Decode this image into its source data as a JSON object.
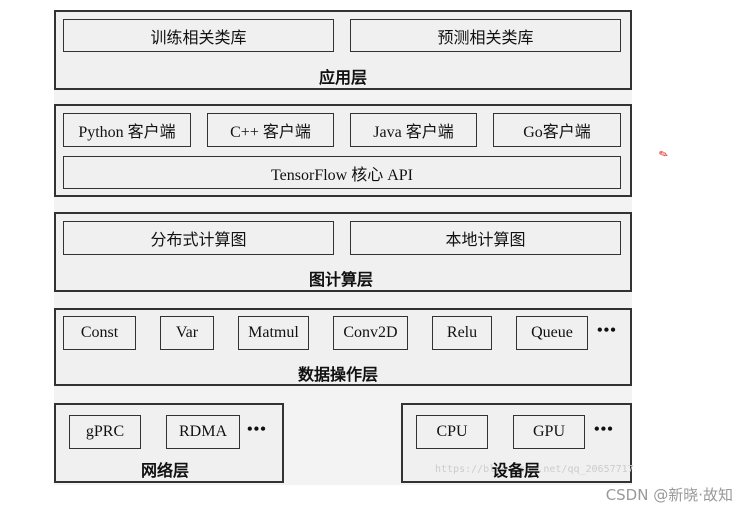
{
  "application_layer": {
    "label": "应用层",
    "items": [
      "训练相关类库",
      "预测相关类库"
    ]
  },
  "client_layer": {
    "items": [
      "Python 客户端",
      "C++ 客户端",
      "Java 客户端",
      "Go客户端"
    ],
    "core_api": "TensorFlow 核心 API"
  },
  "graph_layer": {
    "label": "图计算层",
    "items": [
      "分布式计算图",
      "本地计算图"
    ]
  },
  "data_op_layer": {
    "label": "数据操作层",
    "items": [
      "Const",
      "Var",
      "Matmul",
      "Conv2D",
      "Relu",
      "Queue"
    ],
    "more": "•••"
  },
  "network_layer": {
    "label": "网络层",
    "items": [
      "gPRC",
      "RDMA"
    ],
    "more": "•••"
  },
  "device_layer": {
    "label": "设备层",
    "items": [
      "CPU",
      "GPU"
    ],
    "more": "•••"
  },
  "watermark": "https://blog.csdn.net/qq_20657717",
  "credit": "CSDN @新晓·故知",
  "annotation_icon": "pen-cursor-icon"
}
